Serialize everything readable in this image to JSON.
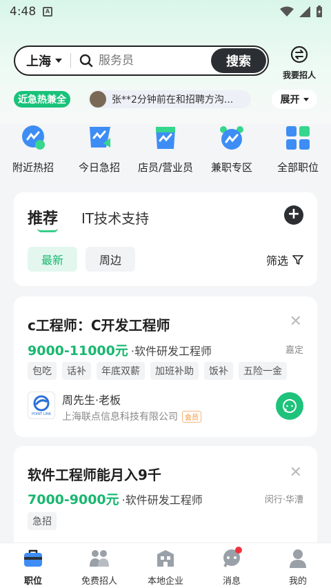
{
  "status_bar": {
    "time": "4:48",
    "sim_label": "A"
  },
  "search": {
    "city": "上海",
    "placeholder": "服务员",
    "button": "搜索"
  },
  "recruit_link": {
    "label": "我要招人"
  },
  "ticker": {
    "badge": "近急热兼全",
    "message": "张**2分钟前在和招聘方沟...",
    "expand_label": "展开"
  },
  "categories": [
    {
      "label": "附近热招",
      "icon": "location-bubble-icon"
    },
    {
      "label": "今日急招",
      "icon": "urgent-flag-icon"
    },
    {
      "label": "店员/营业员",
      "icon": "store-bag-icon"
    },
    {
      "label": "兼职专区",
      "icon": "alarm-clock-icon"
    },
    {
      "label": "全部职位",
      "icon": "grid-icon"
    }
  ],
  "recommend": {
    "tabs": [
      "推荐",
      "IT技术支持"
    ],
    "chips": [
      "最新",
      "周边"
    ],
    "filter_label": "筛选"
  },
  "jobs": [
    {
      "title": "c工程师：C开发工程师",
      "salary": "9000-11000元",
      "category": "·软件研发工程师",
      "location": "嘉定",
      "tags": [
        "包吃",
        "话补",
        "年底双薪",
        "加班补助",
        "饭补",
        "五险一金"
      ],
      "contact": "周先生·老板",
      "company": "上海联点信息科技有限公司",
      "member_badge": "会员",
      "logo_text": "POINT LINK"
    },
    {
      "title": "软件工程师能月入9千",
      "salary": "7000-9000元",
      "category": "·软件研发工程师",
      "location": "闵行·华漕",
      "tags": [
        "急招"
      ]
    }
  ],
  "bottom_nav": [
    {
      "label": "职位",
      "icon": "briefcase-icon",
      "active": true
    },
    {
      "label": "免费招人",
      "icon": "people-icon",
      "active": false
    },
    {
      "label": "本地企业",
      "icon": "building-icon",
      "active": false
    },
    {
      "label": "消息",
      "icon": "message-icon",
      "active": false
    },
    {
      "label": "我的",
      "icon": "person-icon",
      "active": false
    }
  ],
  "colors": {
    "accent": "#18b76f",
    "dark": "#2b2f33",
    "notification": "#f0323c"
  }
}
